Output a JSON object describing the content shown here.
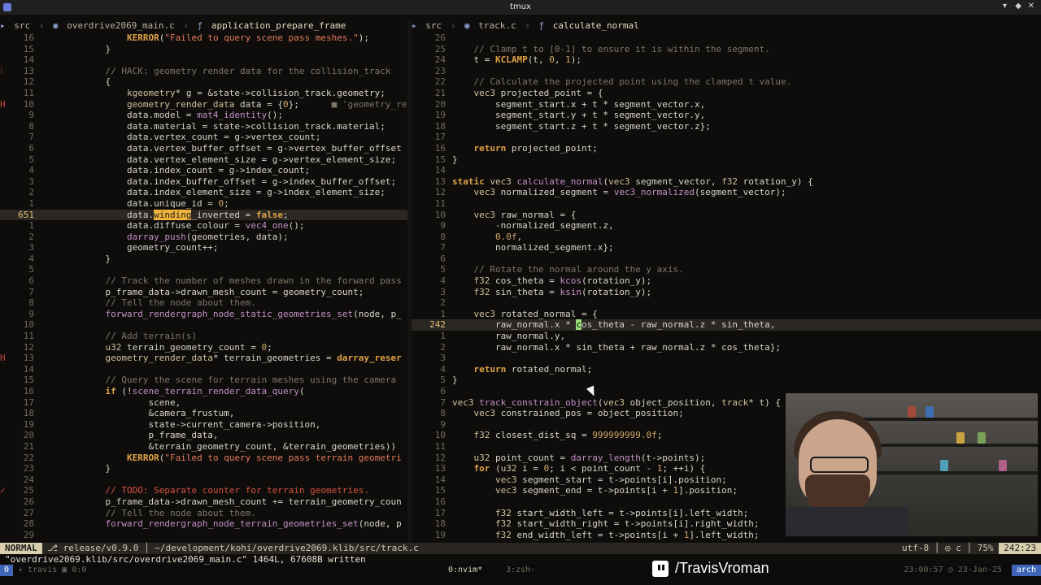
{
  "window": {
    "title": "tmux"
  },
  "left": {
    "crumb": {
      "dir": "src",
      "file": "overdrive2069_main.c",
      "func": "application_prepare_frame"
    },
    "lines": [
      {
        "n": "16",
        "h": "                <span class=\"k\">KERROR</span>(<span class=\"s\">\"Failed to query scene pass meshes.\"</span>);"
      },
      {
        "n": "15",
        "h": "            }"
      },
      {
        "n": "14",
        "h": ""
      },
      {
        "n": "13",
        "sign": "⁝",
        "h": "            <span class=\"c\">// HACK: geometry render data for the collision_track</span>"
      },
      {
        "n": "12",
        "h": "            {"
      },
      {
        "n": "11",
        "h": "                <span class=\"t\">kgeometry</span>* g = &amp;state-&gt;collision_track.geometry;"
      },
      {
        "n": "10",
        "sign": "H",
        "h": "                <span class=\"t\">geometry_render_data</span> data = {<span class=\"n\">0</span>};      <span class=\"c\">■ 'geometry_re</span>"
      },
      {
        "n": "9",
        "h": "                data.model = <span class=\"f\">mat4_identity</span>();"
      },
      {
        "n": "8",
        "h": "                data.material = state-&gt;collision_track.material;"
      },
      {
        "n": "7",
        "h": "                data.vertex_count = g-&gt;vertex_count;"
      },
      {
        "n": "6",
        "h": "                data.vertex_buffer_offset = g-&gt;vertex_buffer_offset"
      },
      {
        "n": "5",
        "h": "                data.vertex_element_size = g-&gt;vertex_element_size;"
      },
      {
        "n": "4",
        "h": "                data.index_count = g-&gt;index_count;"
      },
      {
        "n": "3",
        "h": "                data.index_buffer_offset = g-&gt;index_buffer_offset;"
      },
      {
        "n": "2",
        "h": "                data.index_element_size = g-&gt;index_element_size;"
      },
      {
        "n": "1",
        "h": "                data.unique_id = <span class=\"n\">0</span>;"
      },
      {
        "n": "651",
        "cur": true,
        "h": "                data.<span class=\"hl\">winding</span>_inverted = <span class=\"k\">false</span>;"
      },
      {
        "n": "1",
        "h": "                data.diffuse_colour = <span class=\"f\">vec4_one</span>();"
      },
      {
        "n": "2",
        "h": "                <span class=\"f\">darray_push</span>(geometries, data);"
      },
      {
        "n": "3",
        "h": "                geometry_count++;"
      },
      {
        "n": "4",
        "h": "            }"
      },
      {
        "n": "5",
        "h": ""
      },
      {
        "n": "6",
        "h": "            <span class=\"c\">// Track the number of meshes drawn in the forward pass</span>"
      },
      {
        "n": "7",
        "h": "            p_frame_data-&gt;drawn_mesh_count = geometry_count;"
      },
      {
        "n": "8",
        "h": "            <span class=\"c\">// Tell the node about them.</span>"
      },
      {
        "n": "9",
        "h": "            <span class=\"f\">forward_rendergraph_node_static_geometries_set</span>(node, p_"
      },
      {
        "n": "10",
        "h": ""
      },
      {
        "n": "11",
        "h": "            <span class=\"c\">// Add terrain(s)</span>"
      },
      {
        "n": "12",
        "h": "            <span class=\"t\">u32</span> terrain_geometry_count = <span class=\"n\">0</span>;"
      },
      {
        "n": "13",
        "sign": "H",
        "h": "            <span class=\"t\">geometry_render_data</span>* terrain_geometries = <span class=\"k\">darray_reser</span>"
      },
      {
        "n": "14",
        "h": ""
      },
      {
        "n": "15",
        "h": "            <span class=\"c\">// Query the scene for terrain meshes using the camera</span>"
      },
      {
        "n": "16",
        "h": "            <span class=\"k\">if</span> (!<span class=\"f\">scene_terrain_render_data_query</span>("
      },
      {
        "n": "17",
        "h": "                    scene,"
      },
      {
        "n": "18",
        "h": "                    &amp;camera_frustum,"
      },
      {
        "n": "19",
        "h": "                    state-&gt;current_camera-&gt;position,"
      },
      {
        "n": "20",
        "h": "                    p_frame_data,"
      },
      {
        "n": "21",
        "h": "                    &amp;terrain_geometry_count, &amp;terrain_geometries))"
      },
      {
        "n": "22",
        "h": "                <span class=\"k\">KERROR</span>(<span class=\"s\">\"Failed to query scene pass terrain geometri</span>"
      },
      {
        "n": "23",
        "h": "            }"
      },
      {
        "n": "24",
        "h": ""
      },
      {
        "n": "25",
        "sign": "✓",
        "h": "            <span class=\"red\">// TODO: Separate counter for terrain geometries.</span>"
      },
      {
        "n": "26",
        "h": "            p_frame_data-&gt;drawn_mesh_count += terrain_geometry_coun"
      },
      {
        "n": "27",
        "h": "            <span class=\"c\">// Tell the node about them.</span>"
      },
      {
        "n": "28",
        "h": "            <span class=\"f\">forward_rendergraph_node_terrain_geometries_set</span>(node, p"
      },
      {
        "n": "29",
        "h": ""
      }
    ]
  },
  "right": {
    "crumb": {
      "dir": "src",
      "file": "track.c",
      "func": "calculate_normal"
    },
    "lines": [
      {
        "n": "26",
        "h": ""
      },
      {
        "n": "25",
        "h": "    <span class=\"c\">// Clamp t to [0-1] to ensure it is within the segment.</span>"
      },
      {
        "n": "24",
        "h": "    t = <span class=\"k\">KCLAMP</span>(t, <span class=\"n\">0</span>, <span class=\"n\">1</span>);"
      },
      {
        "n": "23",
        "h": ""
      },
      {
        "n": "22",
        "h": "    <span class=\"c\">// Calculate the projected point using the clamped t value.</span>"
      },
      {
        "n": "21",
        "h": "    <span class=\"t\">vec3</span> projected_point = {"
      },
      {
        "n": "20",
        "h": "        segment_start.x + t * segment_vector.x,"
      },
      {
        "n": "19",
        "h": "        segment_start.y + t * segment_vector.y,"
      },
      {
        "n": "18",
        "h": "        segment_start.z + t * segment_vector.z};"
      },
      {
        "n": "17",
        "h": ""
      },
      {
        "n": "16",
        "h": "    <span class=\"k\">return</span> projected_point;"
      },
      {
        "n": "15",
        "h": "}"
      },
      {
        "n": "14",
        "h": ""
      },
      {
        "n": "13",
        "h": "<span class=\"k\">static</span> <span class=\"t\">vec3</span> <span class=\"f\">calculate_normal</span>(<span class=\"t\">vec3</span> segment_vector, <span class=\"t\">f32</span> rotation_y) {"
      },
      {
        "n": "12",
        "h": "    <span class=\"t\">vec3</span> normalized_segment = <span class=\"f\">vec3_normalized</span>(segment_vector);"
      },
      {
        "n": "11",
        "h": ""
      },
      {
        "n": "10",
        "h": "    <span class=\"t\">vec3</span> raw_normal = {"
      },
      {
        "n": "9",
        "h": "        -normalized_segment.z,"
      },
      {
        "n": "8",
        "h": "        <span class=\"n\">0.0f</span>,"
      },
      {
        "n": "7",
        "h": "        normalized_segment.x};"
      },
      {
        "n": "6",
        "h": ""
      },
      {
        "n": "5",
        "h": "    <span class=\"c\">// Rotate the normal around the y axis.</span>"
      },
      {
        "n": "4",
        "h": "    <span class=\"t\">f32</span> cos_theta = <span class=\"f\">kcos</span>(rotation_y);"
      },
      {
        "n": "3",
        "h": "    <span class=\"t\">f32</span> sin_theta = <span class=\"f\">ksin</span>(rotation_y);"
      },
      {
        "n": "2",
        "h": ""
      },
      {
        "n": "1",
        "h": "    <span class=\"t\">vec3</span> rotated_normal = {"
      },
      {
        "n": "242",
        "cur": true,
        "h": "        raw_normal.x * <span class=\"cursor\">c</span>os_theta - raw_normal.z * sin_theta,"
      },
      {
        "n": "1",
        "h": "        raw_normal.y,"
      },
      {
        "n": "2",
        "h": "        raw_normal.x * sin_theta + raw_normal.z * cos_theta};"
      },
      {
        "n": "3",
        "h": ""
      },
      {
        "n": "4",
        "h": "    <span class=\"k\">return</span> rotated_normal;"
      },
      {
        "n": "5",
        "h": "}"
      },
      {
        "n": "6",
        "h": ""
      },
      {
        "n": "7",
        "h": "<span class=\"t\">vec3</span> <span class=\"f\">track_constrain_object</span>(<span class=\"t\">vec3</span> object_position, <span class=\"t\">track</span>* t) {"
      },
      {
        "n": "8",
        "h": "    <span class=\"t\">vec3</span> constrained_pos = object_position;"
      },
      {
        "n": "9",
        "h": ""
      },
      {
        "n": "10",
        "h": "    <span class=\"t\">f32</span> closest_dist_sq = <span class=\"n\">999999999.0f</span>;"
      },
      {
        "n": "11",
        "h": ""
      },
      {
        "n": "12",
        "h": "    <span class=\"t\">u32</span> point_count = <span class=\"f\">darray_length</span>(t-&gt;points);"
      },
      {
        "n": "13",
        "h": "    <span class=\"k\">for</span> (<span class=\"t\">u32</span> i = <span class=\"n\">0</span>; i &lt; point_count - <span class=\"n\">1</span>; ++i) {"
      },
      {
        "n": "14",
        "h": "        <span class=\"t\">vec3</span> segment_start = t-&gt;points[i].position;"
      },
      {
        "n": "15",
        "h": "        <span class=\"t\">vec3</span> segment_end = t-&gt;points[i + <span class=\"n\">1</span>].position;"
      },
      {
        "n": "16",
        "h": ""
      },
      {
        "n": "17",
        "h": "        <span class=\"t\">f32</span> start_width_left = t-&gt;points[i].left_width;"
      },
      {
        "n": "18",
        "h": "        <span class=\"t\">f32</span> start_width_right = t-&gt;points[i].right_width;"
      },
      {
        "n": "19",
        "h": "        <span class=\"t\">f32</span> end_width_left = t-&gt;points[i + <span class=\"n\">1</span>].left_width;"
      }
    ]
  },
  "status": {
    "mode": "NORMAL",
    "branch": "release/v0.9.0",
    "path": "~/development/kohi/overdrive2069.klib/src/track.c",
    "encoding": "utf-8",
    "lang": "c",
    "percent": "75%",
    "position": "242:23"
  },
  "cmdline": "\"overdrive2069.klib/src/overdrive2069_main.c\" 1464L, 67608B written",
  "tmux": {
    "index": "0",
    "session": "travis",
    "pane": "0:0",
    "win_active": "0:nvim*",
    "win_other": "3:zsh-",
    "time": "23:00:57",
    "date": "23-Jan-25",
    "host": "arch"
  },
  "overlay": {
    "handle": "/TravisVroman"
  }
}
